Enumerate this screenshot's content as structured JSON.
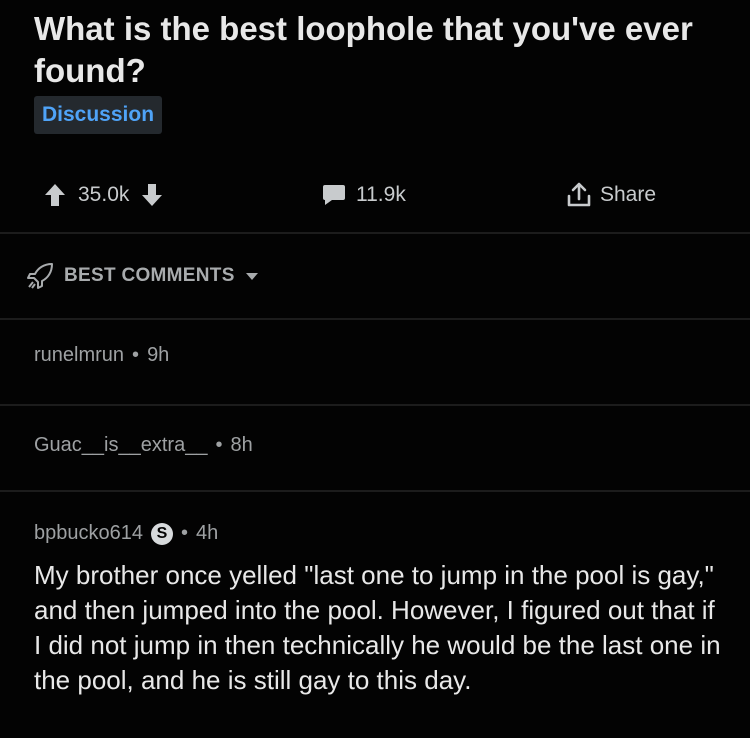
{
  "post": {
    "title": "What is the best loophole that you've ever found?",
    "flair": "Discussion"
  },
  "actions": {
    "upvotes": "35.0k",
    "comments": "11.9k",
    "share": "Share"
  },
  "sort": {
    "label": "BEST COMMENTS"
  },
  "comments": [
    {
      "author": "runelmrun",
      "time": "9h"
    },
    {
      "author": "Guac__is__extra__",
      "time": "8h"
    },
    {
      "author": "bpbucko614",
      "badge": "S",
      "time": "4h",
      "body": "My brother once yelled \"last one to jump in the pool is gay,\" and then jumped into the pool. However, I figured out that if I did not jump in then technically he would be the last one in the pool, and he is still gay to this day."
    }
  ],
  "colors": {
    "background": "#030303",
    "flair_text": "#4fa3f7",
    "text": "#e8e8e8",
    "meta": "#9ea1a3"
  }
}
